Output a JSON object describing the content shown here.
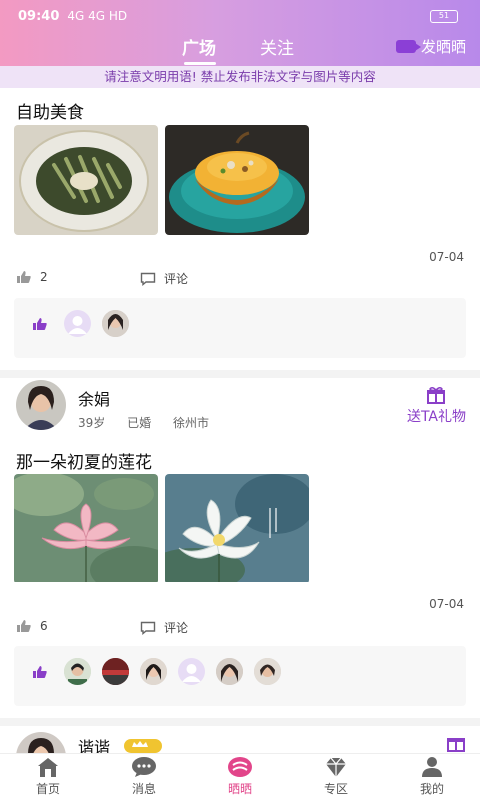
{
  "status": {
    "time": "09:40",
    "signal": "4G 4G HD",
    "battery": "51"
  },
  "header": {
    "tabs": [
      "广场",
      "关注"
    ],
    "active_tab": 0,
    "post_label": "发晒晒"
  },
  "notice": "请注意文明用语! 禁止发布非法文字与图片等内容",
  "posts": [
    {
      "title": "自助美食",
      "date": "07-04",
      "likes": "2",
      "comment_label": "评论"
    },
    {
      "user": {
        "name": "余娟",
        "age": "39岁",
        "marital": "已婚",
        "city": "徐州市"
      },
      "gift_label": "送TA礼物",
      "title": "那一朵初夏的莲花",
      "date": "07-04",
      "likes": "6",
      "comment_label": "评论"
    },
    {
      "user": {
        "name": "谐谐"
      }
    }
  ],
  "bottom_nav": [
    {
      "label": "首页",
      "icon": "home-icon"
    },
    {
      "label": "消息",
      "icon": "message-icon"
    },
    {
      "label": "晒晒",
      "icon": "share-icon",
      "active": true
    },
    {
      "label": "专区",
      "icon": "diamond-icon"
    },
    {
      "label": "我的",
      "icon": "person-icon"
    }
  ],
  "colors": {
    "accent": "#e2458a",
    "purple": "#8a3fc8",
    "header_start": "#f39ac2",
    "header_end": "#b889ea"
  }
}
